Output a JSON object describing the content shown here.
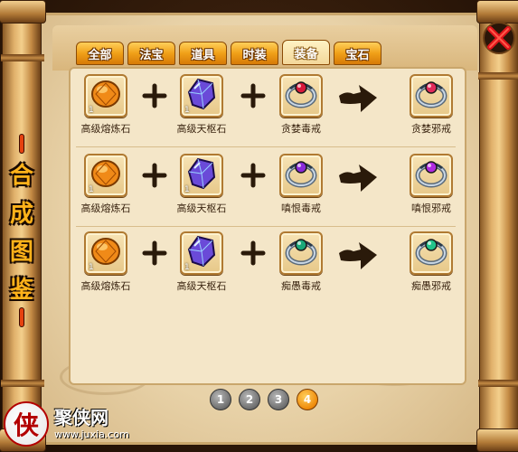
{
  "tabs": [
    {
      "label": "全部",
      "active": false
    },
    {
      "label": "法宝",
      "active": false
    },
    {
      "label": "道具",
      "active": false
    },
    {
      "label": "时装",
      "active": false
    },
    {
      "label": "装备",
      "active": true
    },
    {
      "label": "宝石",
      "active": false
    }
  ],
  "side_title": [
    "合",
    "成",
    "图",
    "鉴"
  ],
  "recipes": [
    {
      "ingredient1": {
        "name": "高级熔炼石",
        "qty": "1",
        "icon": "orange-gem-icon",
        "color": "#f08a18"
      },
      "ingredient2": {
        "name": "高级天枢石",
        "qty": "1",
        "icon": "purple-crystal-icon",
        "color": "#6a4ad8"
      },
      "ingredient3": {
        "name": "贪婪毒戒",
        "icon": "ring-icon",
        "gem_color": "#d8183a"
      },
      "result": {
        "name": "贪婪邪戒",
        "icon": "ring-icon",
        "gem_color": "#e02a5a"
      }
    },
    {
      "ingredient1": {
        "name": "高级熔炼石",
        "qty": "1",
        "icon": "orange-gem-icon",
        "color": "#f08a18"
      },
      "ingredient2": {
        "name": "高级天枢石",
        "qty": "1",
        "icon": "purple-crystal-icon",
        "color": "#6a4ad8"
      },
      "ingredient3": {
        "name": "嗔恨毒戒",
        "icon": "ring-icon",
        "gem_color": "#8a2ad8"
      },
      "result": {
        "name": "嗔恨邪戒",
        "icon": "ring-icon",
        "gem_color": "#b02ae0"
      }
    },
    {
      "ingredient1": {
        "name": "高级熔炼石",
        "qty": "1",
        "icon": "orange-gem-icon",
        "color": "#f08a18"
      },
      "ingredient2": {
        "name": "高级天枢石",
        "qty": "1",
        "icon": "purple-crystal-icon",
        "color": "#6a4ad8"
      },
      "ingredient3": {
        "name": "痴愚毒戒",
        "icon": "ring-icon",
        "gem_color": "#1aa878"
      },
      "result": {
        "name": "痴愚邪戒",
        "icon": "ring-icon",
        "gem_color": "#22c48a"
      }
    }
  ],
  "pagination": {
    "pages": [
      "1",
      "2",
      "3",
      "4"
    ],
    "current": "4"
  },
  "watermark": {
    "badge": "侠",
    "name": "聚侠网",
    "url": "www.juxia.com"
  },
  "colors": {
    "tab": "#f0a018",
    "page_active": "#ef8a0a",
    "title": "#ffb21a"
  }
}
